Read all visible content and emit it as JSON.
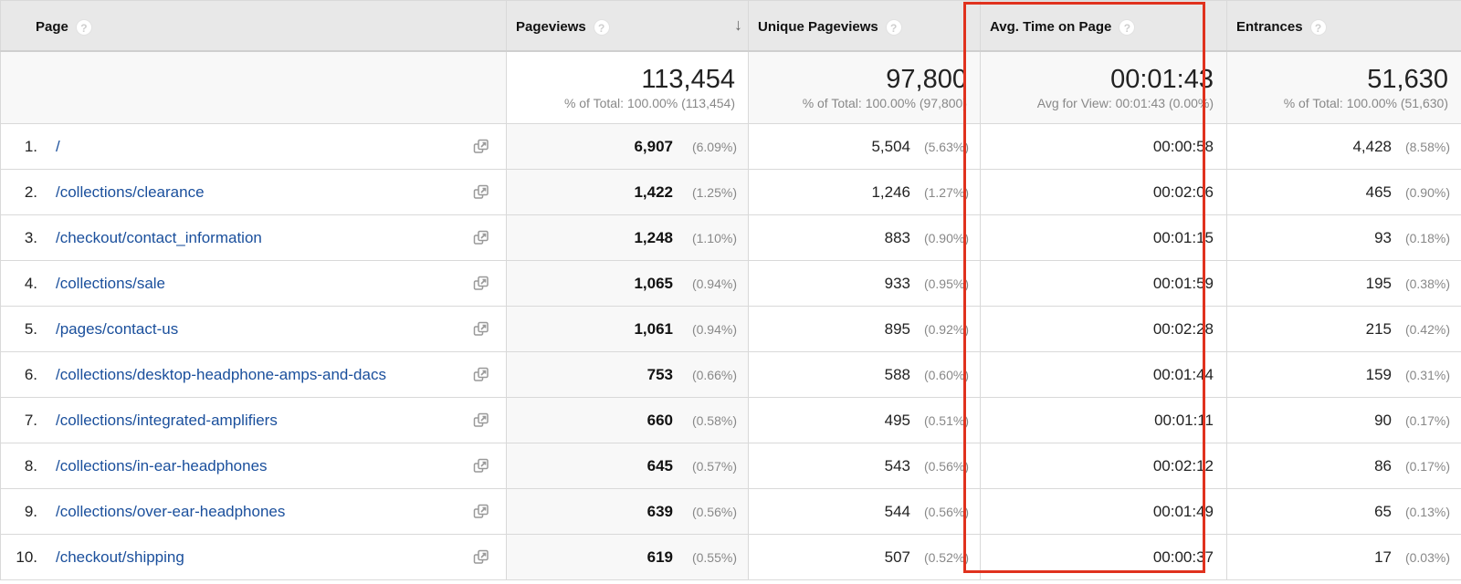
{
  "columns": {
    "page": "Page",
    "pageviews": "Pageviews",
    "unique_pageviews": "Unique Pageviews",
    "avg_time": "Avg. Time on Page",
    "entrances": "Entrances",
    "help_glyph": "?",
    "sort_glyph": "↓"
  },
  "totals": {
    "pageviews": "113,454",
    "pageviews_sub": "% of Total: 100.00% (113,454)",
    "unique_pageviews": "97,800",
    "unique_pageviews_sub": "% of Total: 100.00% (97,800)",
    "avg_time": "00:01:43",
    "avg_time_sub": "Avg for View: 00:01:43 (0.00%)",
    "entrances": "51,630",
    "entrances_sub": "% of Total: 100.00% (51,630)"
  },
  "rows": [
    {
      "num": "1.",
      "page": "/",
      "pv": "6,907",
      "pv_pct": "(6.09%)",
      "upv": "5,504",
      "upv_pct": "(5.63%)",
      "atp": "00:00:58",
      "ent": "4,428",
      "ent_pct": "(8.58%)"
    },
    {
      "num": "2.",
      "page": "/collections/clearance",
      "pv": "1,422",
      "pv_pct": "(1.25%)",
      "upv": "1,246",
      "upv_pct": "(1.27%)",
      "atp": "00:02:06",
      "ent": "465",
      "ent_pct": "(0.90%)"
    },
    {
      "num": "3.",
      "page": "/checkout/contact_information",
      "pv": "1,248",
      "pv_pct": "(1.10%)",
      "upv": "883",
      "upv_pct": "(0.90%)",
      "atp": "00:01:15",
      "ent": "93",
      "ent_pct": "(0.18%)"
    },
    {
      "num": "4.",
      "page": "/collections/sale",
      "pv": "1,065",
      "pv_pct": "(0.94%)",
      "upv": "933",
      "upv_pct": "(0.95%)",
      "atp": "00:01:59",
      "ent": "195",
      "ent_pct": "(0.38%)"
    },
    {
      "num": "5.",
      "page": "/pages/contact-us",
      "pv": "1,061",
      "pv_pct": "(0.94%)",
      "upv": "895",
      "upv_pct": "(0.92%)",
      "atp": "00:02:28",
      "ent": "215",
      "ent_pct": "(0.42%)"
    },
    {
      "num": "6.",
      "page": "/collections/desktop-headphone-amps-and-dacs",
      "pv": "753",
      "pv_pct": "(0.66%)",
      "upv": "588",
      "upv_pct": "(0.60%)",
      "atp": "00:01:44",
      "ent": "159",
      "ent_pct": "(0.31%)"
    },
    {
      "num": "7.",
      "page": "/collections/integrated-amplifiers",
      "pv": "660",
      "pv_pct": "(0.58%)",
      "upv": "495",
      "upv_pct": "(0.51%)",
      "atp": "00:01:11",
      "ent": "90",
      "ent_pct": "(0.17%)"
    },
    {
      "num": "8.",
      "page": "/collections/in-ear-headphones",
      "pv": "645",
      "pv_pct": "(0.57%)",
      "upv": "543",
      "upv_pct": "(0.56%)",
      "atp": "00:02:12",
      "ent": "86",
      "ent_pct": "(0.17%)"
    },
    {
      "num": "9.",
      "page": "/collections/over-ear-headphones",
      "pv": "639",
      "pv_pct": "(0.56%)",
      "upv": "544",
      "upv_pct": "(0.56%)",
      "atp": "00:01:49",
      "ent": "65",
      "ent_pct": "(0.13%)"
    },
    {
      "num": "10.",
      "page": "/checkout/shipping",
      "pv": "619",
      "pv_pct": "(0.55%)",
      "upv": "507",
      "upv_pct": "(0.52%)",
      "atp": "00:00:37",
      "ent": "17",
      "ent_pct": "(0.03%)"
    }
  ],
  "icons": {
    "help": "help-icon",
    "sort": "sort-descending-icon",
    "open_page": "open-in-new-window-icon"
  },
  "colors": {
    "link": "#1a4f9c",
    "highlight": "#e0321e",
    "header_bg": "#e8e8e8"
  }
}
